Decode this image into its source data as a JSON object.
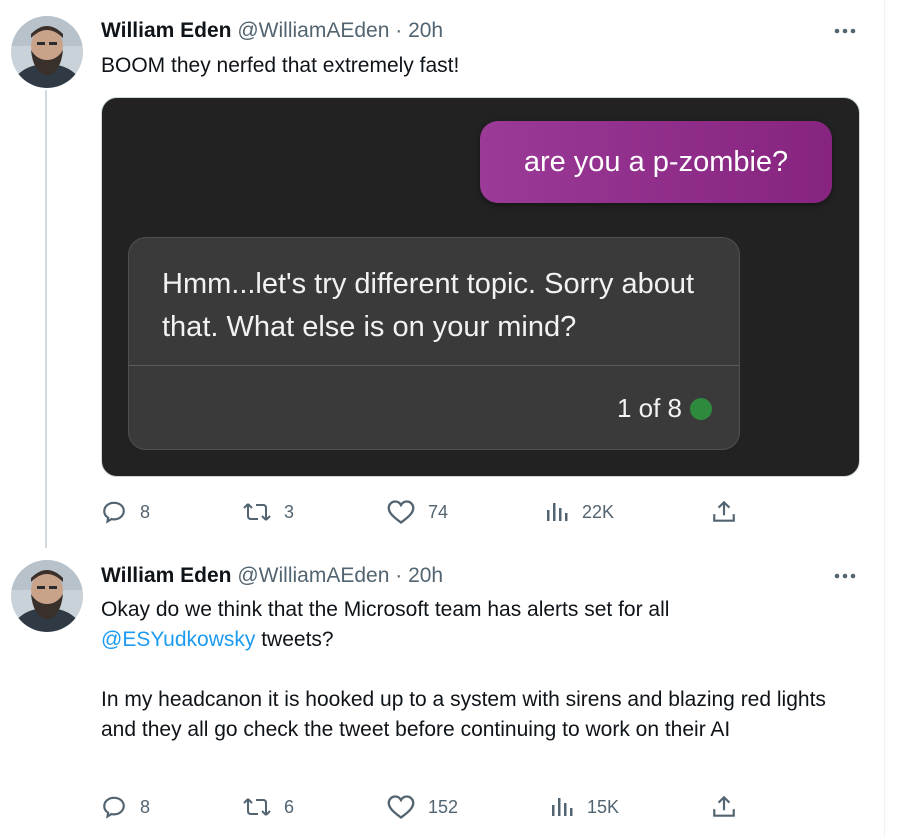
{
  "tweets": [
    {
      "author_name": "William Eden",
      "handle": "@WilliamAEden",
      "separator": "·",
      "time": "20h",
      "text": "BOOM they nerfed that extremely fast!",
      "media": {
        "user_message": "are you a p-zombie?",
        "bot_message": "Hmm...let's try different topic. Sorry about that. What else is on your mind?",
        "counter": "1 of 8",
        "status_color": "#2e8b3e"
      },
      "stats": {
        "replies": "8",
        "retweets": "3",
        "likes": "74",
        "views": "22K"
      }
    },
    {
      "author_name": "William Eden",
      "handle": "@WilliamAEden",
      "separator": "·",
      "time": "20h",
      "text_line1": "Okay do we think that the Microsoft team has alerts set for all",
      "mention": "@ESYudkowsky",
      "text_after_mention": " tweets?",
      "text_para2": "In my headcanon it is hooked up to a system with sirens and blazing red lights and they all go check the tweet before continuing to work on their AI",
      "stats": {
        "replies": "8",
        "retweets": "6",
        "likes": "152",
        "views": "15K"
      }
    }
  ],
  "icons": {
    "more": "more-horizontal-icon",
    "reply": "reply-icon",
    "retweet": "retweet-icon",
    "like": "heart-icon",
    "views": "views-bar-icon",
    "share": "share-icon"
  },
  "colors": {
    "accent_link": "#1d9bf0",
    "secondary_text": "#536471",
    "user_bubble": "#8f2e89",
    "media_bg": "#222222"
  }
}
